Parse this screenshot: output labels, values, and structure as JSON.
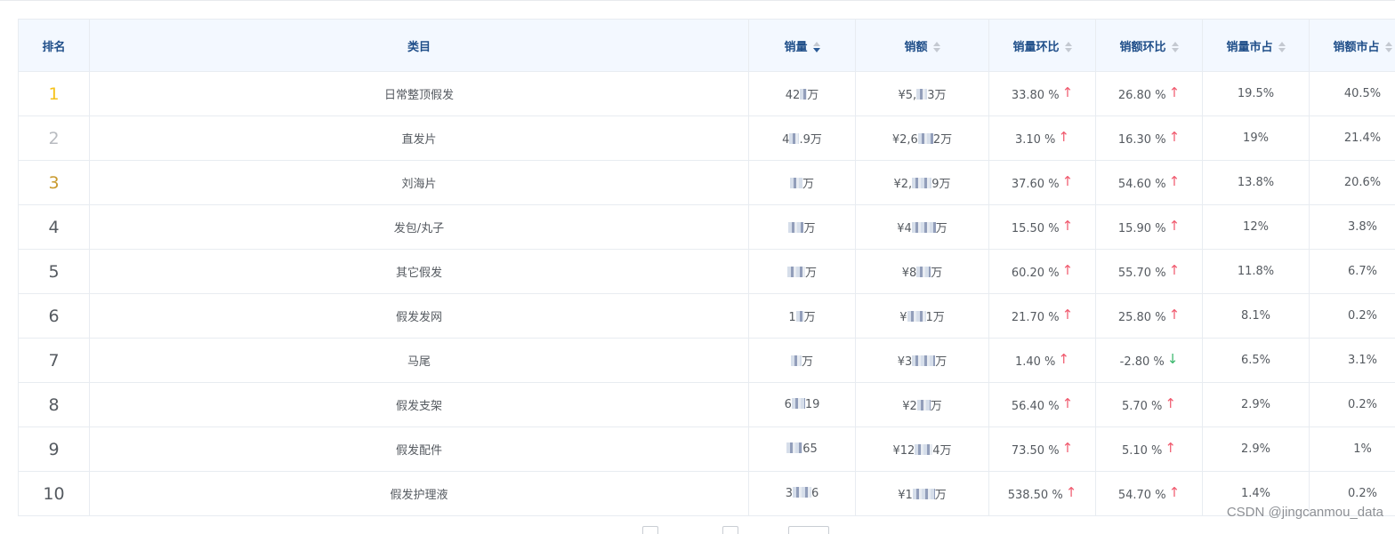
{
  "table": {
    "headers": {
      "rank": "排名",
      "category": "类目",
      "sales_qty": "销量",
      "sales_amount": "销额",
      "qty_mom": "销量环比",
      "amount_mom": "销额环比",
      "qty_share": "销量市占",
      "amount_share": "销额市占"
    },
    "sort": {
      "column": "sales_qty",
      "direction": "desc"
    },
    "rows": [
      {
        "rank": "1",
        "category": "日常整顶假发",
        "qty_prefix": "42",
        "qty_suffix": "万",
        "amount_prefix": "¥5,",
        "amount_suffix": "3万",
        "qty_mom": "33.80 %",
        "qty_trend": "up",
        "amount_mom": "26.80 %",
        "amount_trend": "up",
        "qty_share": "19.5%",
        "amount_share": "40.5%"
      },
      {
        "rank": "2",
        "category": "直发片",
        "qty_prefix": "4",
        "qty_suffix": ".9万",
        "amount_prefix": "¥2,6",
        "amount_suffix": "2万",
        "qty_mom": "3.10 %",
        "qty_trend": "up",
        "amount_mom": "16.30 %",
        "amount_trend": "up",
        "qty_share": "19%",
        "amount_share": "21.4%"
      },
      {
        "rank": "3",
        "category": "刘海片",
        "qty_prefix": "",
        "qty_suffix": "万",
        "amount_prefix": "¥2,",
        "amount_suffix": "9万",
        "qty_mom": "37.60 %",
        "qty_trend": "up",
        "amount_mom": "54.60 %",
        "amount_trend": "up",
        "qty_share": "13.8%",
        "amount_share": "20.6%"
      },
      {
        "rank": "4",
        "category": "发包/丸子",
        "qty_prefix": "",
        "qty_suffix": "万",
        "amount_prefix": "¥4",
        "amount_suffix": "万",
        "qty_mom": "15.50 %",
        "qty_trend": "up",
        "amount_mom": "15.90 %",
        "amount_trend": "up",
        "qty_share": "12%",
        "amount_share": "3.8%"
      },
      {
        "rank": "5",
        "category": "其它假发",
        "qty_prefix": "",
        "qty_suffix": "万",
        "amount_prefix": "¥8",
        "amount_suffix": "万",
        "qty_mom": "60.20 %",
        "qty_trend": "up",
        "amount_mom": "55.70 %",
        "amount_trend": "up",
        "qty_share": "11.8%",
        "amount_share": "6.7%"
      },
      {
        "rank": "6",
        "category": "假发发网",
        "qty_prefix": "1",
        "qty_suffix": "万",
        "amount_prefix": "¥",
        "amount_suffix": "1万",
        "qty_mom": "21.70 %",
        "qty_trend": "up",
        "amount_mom": "25.80 %",
        "amount_trend": "up",
        "qty_share": "8.1%",
        "amount_share": "0.2%"
      },
      {
        "rank": "7",
        "category": "马尾",
        "qty_prefix": "",
        "qty_suffix": "万",
        "amount_prefix": "¥3",
        "amount_suffix": "万",
        "qty_mom": "1.40 %",
        "qty_trend": "up",
        "amount_mom": "-2.80 %",
        "amount_trend": "down",
        "qty_share": "6.5%",
        "amount_share": "3.1%"
      },
      {
        "rank": "8",
        "category": "假发支架",
        "qty_prefix": "6",
        "qty_suffix": "19",
        "amount_prefix": "¥2",
        "amount_suffix": "万",
        "qty_mom": "56.40 %",
        "qty_trend": "up",
        "amount_mom": "5.70 %",
        "amount_trend": "up",
        "qty_share": "2.9%",
        "amount_share": "0.2%"
      },
      {
        "rank": "9",
        "category": "假发配件",
        "qty_prefix": "",
        "qty_suffix": "65",
        "amount_prefix": "¥12",
        "amount_suffix": "4万",
        "qty_mom": "73.50 %",
        "qty_trend": "up",
        "amount_mom": "5.10 %",
        "amount_trend": "up",
        "qty_share": "2.9%",
        "amount_share": "1%"
      },
      {
        "rank": "10",
        "category": "假发护理液",
        "qty_prefix": "3",
        "qty_suffix": "6",
        "amount_prefix": "¥1",
        "amount_suffix": "万",
        "qty_mom": "538.50 %",
        "qty_trend": "up",
        "amount_mom": "54.70 %",
        "amount_trend": "up",
        "qty_share": "1.4%",
        "amount_share": "0.2%"
      }
    ]
  },
  "watermark": "CSDN @jingcanmou_data",
  "icons": {
    "up": "arrow-up-icon",
    "down": "arrow-down-icon",
    "sort": "sort-caret-icon"
  },
  "colors": {
    "header_bg": "#f3f8ff",
    "header_text": "#1f4e89",
    "up": "#f05a6e",
    "down": "#37b66a",
    "rank1": "#f6c21b",
    "rank2": "#b8bbc0",
    "rank3": "#c99a2e"
  }
}
